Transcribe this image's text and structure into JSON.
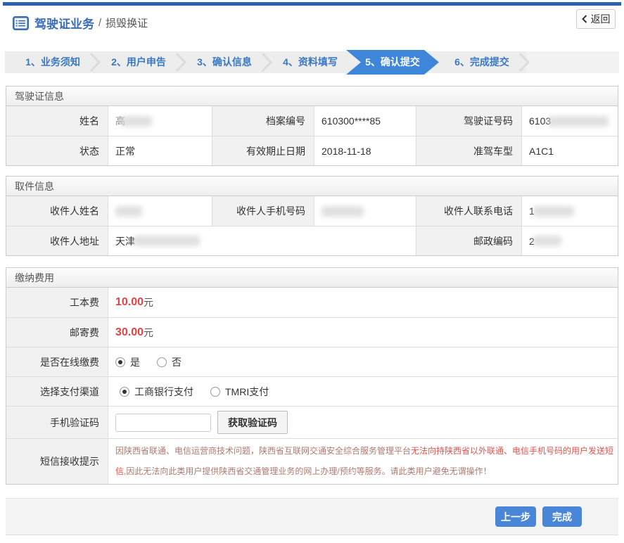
{
  "header": {
    "title": "驾驶证业务",
    "separator": "/",
    "subtitle": "损毁换证",
    "back_label": "返回"
  },
  "steps": [
    {
      "label": "1、业务须知",
      "state": "normal"
    },
    {
      "label": "2、用户申告",
      "state": "normal"
    },
    {
      "label": "3、确认信息",
      "state": "normal"
    },
    {
      "label": "4、资料填写",
      "state": "normal"
    },
    {
      "label": "5、确认提交",
      "state": "active"
    },
    {
      "label": "6、完成提交",
      "state": "normal"
    }
  ],
  "license": {
    "title": "驾驶证信息",
    "name_label": "姓名",
    "name_value": "高",
    "file_no_label": "档案编号",
    "file_no_value": "610300****85",
    "license_no_label": "驾驶证号码",
    "license_no_value": "6103",
    "status_label": "状态",
    "status_value": "正常",
    "expiry_label": "有效期止日期",
    "expiry_value": "2018-11-18",
    "class_label": "准驾车型",
    "class_value": "A1C1"
  },
  "pickup": {
    "title": "取件信息",
    "recipient_name_label": "收件人姓名",
    "recipient_name_value": "",
    "mobile_label": "收件人手机号码",
    "mobile_value": "",
    "tel_label": "收件人联系电话",
    "tel_value": "1",
    "address_label": "收件人地址",
    "address_value": "天津",
    "zip_label": "邮政编码",
    "zip_value": "2"
  },
  "fees": {
    "title": "缴纳费用",
    "cost_label": "工本费",
    "cost_value": "10.00",
    "cost_unit": "元",
    "postage_label": "邮寄费",
    "postage_value": "30.00",
    "postage_unit": "元",
    "online_label": "是否在线缴费",
    "online_yes": "是",
    "online_no": "否",
    "online_selected": "是",
    "channel_label": "选择支付渠道",
    "channel_icbc": "工商银行支付",
    "channel_tmri": "TMRI支付",
    "channel_selected": "工商银行支付",
    "captcha_label": "手机验证码",
    "captcha_value": "",
    "captcha_button": "获取验证码",
    "notice_label": "短信接收提示",
    "notice_part1": "因陕西省联通、电信运营商技术问题，陕西省互联网交通安全综合服务管理平台",
    "notice_emphasis": "无法向持陕西省以外联通、电信手机号码的用户发送短信",
    "notice_part2": ",因此无法向此类用户提供陕西省交通管理业务的网上办理/预约等服务。请此类用户避免无谓操作！"
  },
  "footer": {
    "prev_label": "上一步",
    "done_label": "完成"
  },
  "colors": {
    "accent_blue": "#3e86da",
    "top_border": "#2b61ae",
    "fee_red": "#e04343",
    "notice_red": "#e0534e"
  }
}
